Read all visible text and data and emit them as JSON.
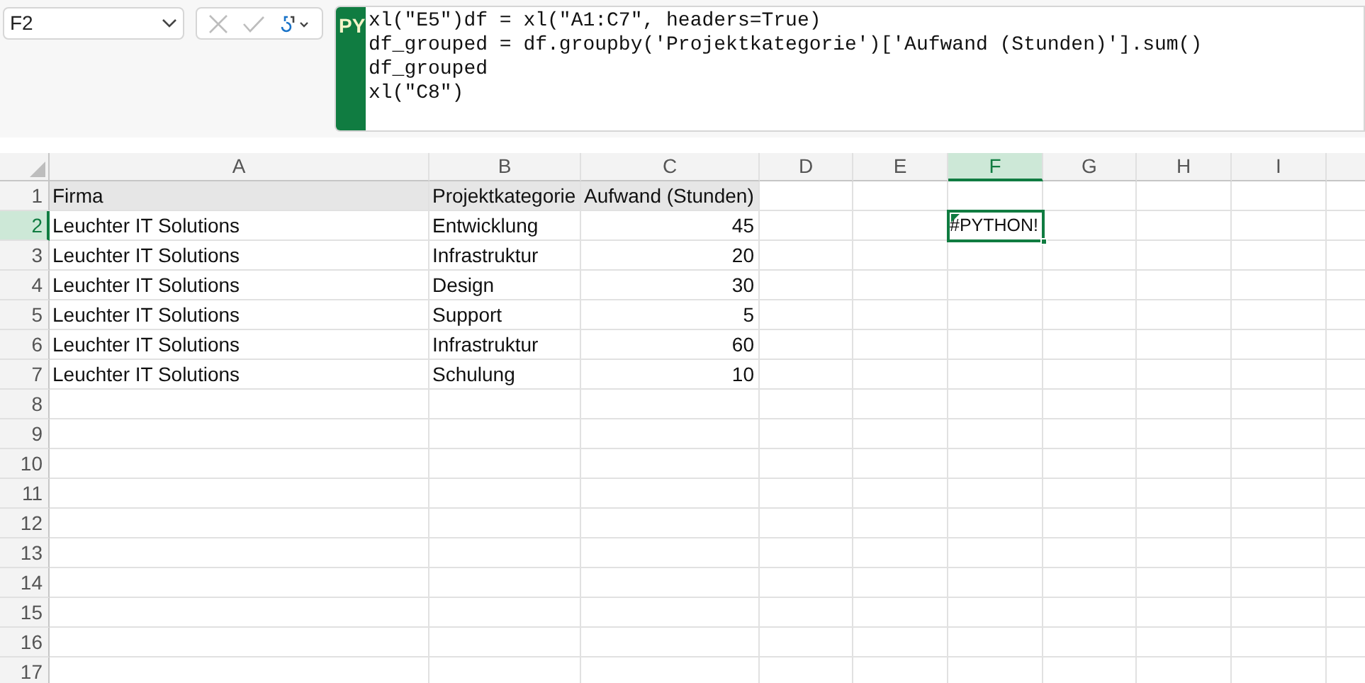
{
  "name_box": {
    "value": "F2"
  },
  "formula_bar": {
    "badge": "PY",
    "lines": [
      "xl(\"E5\")df = xl(\"A1:C7\", headers=True)",
      "df_grouped = df.groupby('Projektkategorie')['Aufwand (Stunden)'].sum()",
      "df_grouped",
      "xl(\"C8\")"
    ]
  },
  "columns": [
    {
      "label": "A",
      "selected": false
    },
    {
      "label": "B",
      "selected": false
    },
    {
      "label": "C",
      "selected": false
    },
    {
      "label": "D",
      "selected": false
    },
    {
      "label": "E",
      "selected": false
    },
    {
      "label": "F",
      "selected": true
    },
    {
      "label": "G",
      "selected": false
    },
    {
      "label": "H",
      "selected": false
    },
    {
      "label": "I",
      "selected": false
    }
  ],
  "rows": [
    {
      "number": "1",
      "selected": false,
      "kind": "table_header",
      "cells": {
        "A": {
          "text": "Firma",
          "kind": "text",
          "selected": false
        },
        "B": {
          "text": "Projektkategorie",
          "kind": "text",
          "selected": false
        },
        "C": {
          "text": "Aufwand (Stunden)",
          "kind": "text",
          "selected": false
        }
      }
    },
    {
      "number": "2",
      "selected": true,
      "kind": "data",
      "cells": {
        "A": {
          "text": "Leuchter IT Solutions",
          "kind": "text",
          "selected": false
        },
        "B": {
          "text": "Entwicklung",
          "kind": "text",
          "selected": false
        },
        "C": {
          "text": "45",
          "kind": "number",
          "selected": false
        },
        "F": {
          "text": "#PYTHON!",
          "kind": "error",
          "selected": true
        }
      }
    },
    {
      "number": "3",
      "selected": false,
      "kind": "data",
      "cells": {
        "A": {
          "text": "Leuchter IT Solutions",
          "kind": "text",
          "selected": false
        },
        "B": {
          "text": "Infrastruktur",
          "kind": "text",
          "selected": false
        },
        "C": {
          "text": "20",
          "kind": "number",
          "selected": false
        }
      }
    },
    {
      "number": "4",
      "selected": false,
      "kind": "data",
      "cells": {
        "A": {
          "text": "Leuchter IT Solutions",
          "kind": "text",
          "selected": false
        },
        "B": {
          "text": "Design",
          "kind": "text",
          "selected": false
        },
        "C": {
          "text": "30",
          "kind": "number",
          "selected": false
        }
      }
    },
    {
      "number": "5",
      "selected": false,
      "kind": "data",
      "cells": {
        "A": {
          "text": "Leuchter IT Solutions",
          "kind": "text",
          "selected": false
        },
        "B": {
          "text": "Support",
          "kind": "text",
          "selected": false
        },
        "C": {
          "text": "5",
          "kind": "number",
          "selected": false
        }
      }
    },
    {
      "number": "6",
      "selected": false,
      "kind": "data",
      "cells": {
        "A": {
          "text": "Leuchter IT Solutions",
          "kind": "text",
          "selected": false
        },
        "B": {
          "text": "Infrastruktur",
          "kind": "text",
          "selected": false
        },
        "C": {
          "text": "60",
          "kind": "number",
          "selected": false
        }
      }
    },
    {
      "number": "7",
      "selected": false,
      "kind": "data",
      "cells": {
        "A": {
          "text": "Leuchter IT Solutions",
          "kind": "text",
          "selected": false
        },
        "B": {
          "text": "Schulung",
          "kind": "text",
          "selected": false
        },
        "C": {
          "text": "10",
          "kind": "number",
          "selected": false
        }
      }
    },
    {
      "number": "8",
      "selected": false,
      "kind": "data"
    },
    {
      "number": "9",
      "selected": false,
      "kind": "data"
    },
    {
      "number": "10",
      "selected": false,
      "kind": "data"
    },
    {
      "number": "11",
      "selected": false,
      "kind": "data"
    },
    {
      "number": "12",
      "selected": false,
      "kind": "data"
    },
    {
      "number": "13",
      "selected": false,
      "kind": "data"
    },
    {
      "number": "14",
      "selected": false,
      "kind": "data"
    },
    {
      "number": "15",
      "selected": false,
      "kind": "data"
    },
    {
      "number": "16",
      "selected": false,
      "kind": "data"
    },
    {
      "number": "17",
      "selected": false,
      "kind": "data"
    }
  ]
}
